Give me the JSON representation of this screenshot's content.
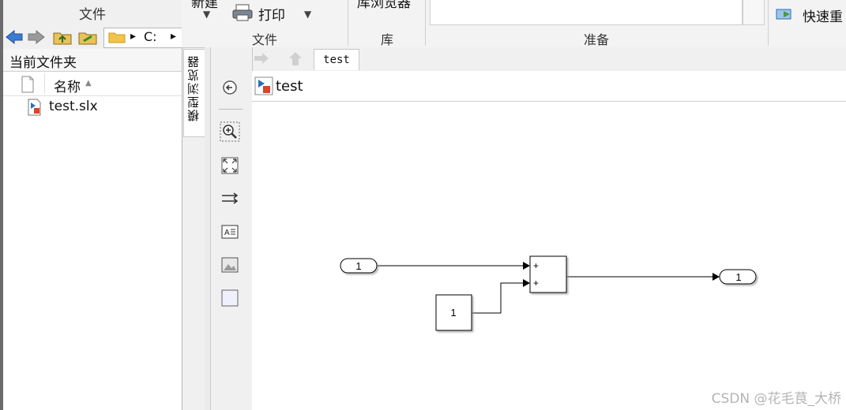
{
  "left_panel": {
    "header_title": "文件",
    "address_path": "C:",
    "current_folder_title": "当前文件夹",
    "column_name": "名称",
    "files": [
      {
        "name": "test.slx"
      }
    ]
  },
  "toolstrip": {
    "new_label": "新建",
    "print_label": "打印",
    "library_browser_label": "库浏览器",
    "quick_label": "快速重",
    "sections": {
      "file": "文件",
      "library": "库",
      "prepare": "准备"
    }
  },
  "model_browser": {
    "label": "模型浏览器"
  },
  "editor": {
    "tab_label": "test",
    "breadcrumb_model": "test"
  },
  "diagram": {
    "inport_label": "1",
    "constant_value": "1",
    "sum_signs": [
      "+",
      "+"
    ],
    "outport_label": "1"
  },
  "watermark": "CSDN @花毛茛_大桥",
  "colors": {
    "link_blue": "#2a6ebb",
    "arrow_green": "#4a9a3a"
  }
}
